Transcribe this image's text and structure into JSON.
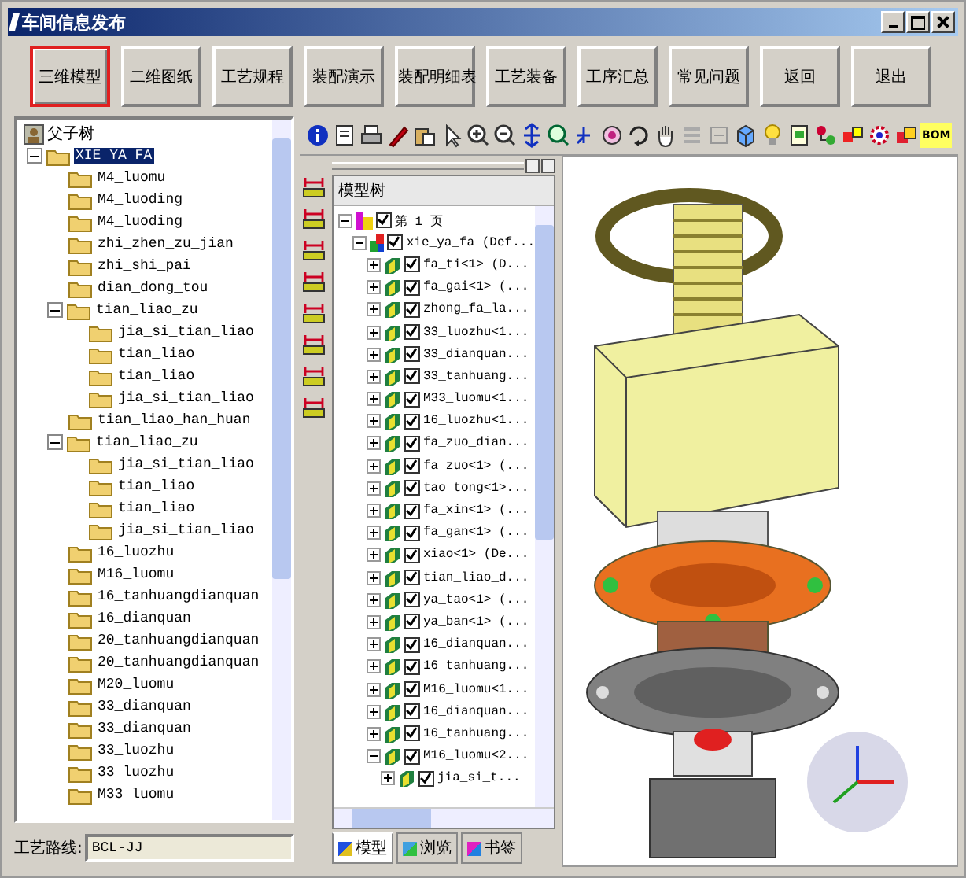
{
  "window": {
    "title": "车间信息发布"
  },
  "buttons": [
    {
      "label": "三维模型",
      "selected": true
    },
    {
      "label": "二维图纸",
      "selected": false
    },
    {
      "label": "工艺规程",
      "selected": false
    },
    {
      "label": "装配演示",
      "selected": false
    },
    {
      "label": "装配明细表",
      "selected": false
    },
    {
      "label": "工艺装备",
      "selected": false
    },
    {
      "label": "工序汇总",
      "selected": false
    },
    {
      "label": "常见问题",
      "selected": false
    },
    {
      "label": "返回",
      "selected": false
    },
    {
      "label": "退出",
      "selected": false
    }
  ],
  "parts_tree": {
    "title": "父子树",
    "items": [
      {
        "label": "XIE_YA_FA",
        "selected": true,
        "expanded": true,
        "children": [
          {
            "label": "M4_luomu",
            "selected": false
          },
          {
            "label": "M4_luoding",
            "selected": false
          },
          {
            "label": "M4_luoding",
            "selected": false
          },
          {
            "label": "zhi_zhen_zu_jian",
            "selected": false
          },
          {
            "label": "zhi_shi_pai",
            "selected": false
          },
          {
            "label": "dian_dong_tou",
            "selected": false
          },
          {
            "label": "tian_liao_zu",
            "selected": false,
            "expanded": true,
            "children": [
              {
                "label": "jia_si_tian_liao",
                "selected": false
              },
              {
                "label": "tian_liao",
                "selected": false
              },
              {
                "label": "tian_liao",
                "selected": false
              },
              {
                "label": "jia_si_tian_liao",
                "selected": false
              }
            ]
          },
          {
            "label": "tian_liao_han_huan",
            "selected": false
          },
          {
            "label": "tian_liao_zu",
            "selected": false,
            "expanded": true,
            "children": [
              {
                "label": "jia_si_tian_liao",
                "selected": false
              },
              {
                "label": "tian_liao",
                "selected": false
              },
              {
                "label": "tian_liao",
                "selected": false
              },
              {
                "label": "jia_si_tian_liao",
                "selected": false
              }
            ]
          },
          {
            "label": "16_luozhu",
            "selected": false
          },
          {
            "label": "M16_luomu",
            "selected": false
          },
          {
            "label": "16_tanhuangdianquan",
            "selected": false
          },
          {
            "label": "16_dianquan",
            "selected": false
          },
          {
            "label": "20_tanhuangdianquan",
            "selected": false
          },
          {
            "label": "20_tanhuangdianquan",
            "selected": false
          },
          {
            "label": "M20_luomu",
            "selected": false
          },
          {
            "label": "33_dianquan",
            "selected": false
          },
          {
            "label": "33_dianquan",
            "selected": false
          },
          {
            "label": "33_luozhu",
            "selected": false
          },
          {
            "label": "33_luozhu",
            "selected": false
          },
          {
            "label": "M33_luomu",
            "selected": false
          }
        ]
      }
    ]
  },
  "route": {
    "label": "工艺路线:",
    "value": "BCL-JJ"
  },
  "toolbar": {
    "bom_label": "BOM"
  },
  "model_tree": {
    "header": "模型树",
    "items": [
      {
        "kind": "page",
        "label": "第 1 页",
        "checked": true,
        "expanded": true,
        "children": [
          {
            "kind": "assembly",
            "label": "xie_ya_fa (Def...",
            "checked": true,
            "expanded": true,
            "children": [
              {
                "kind": "part",
                "label": "fa_ti<1> (D...",
                "checked": true,
                "expanded": false
              },
              {
                "kind": "part",
                "label": "fa_gai<1> (...",
                "checked": true,
                "expanded": false
              },
              {
                "kind": "part",
                "label": "zhong_fa_la...",
                "checked": true,
                "expanded": false
              },
              {
                "kind": "part",
                "label": "33_luozhu<1...",
                "checked": true,
                "expanded": false
              },
              {
                "kind": "part",
                "label": "33_dianquan...",
                "checked": true,
                "expanded": false
              },
              {
                "kind": "part",
                "label": "33_tanhuang...",
                "checked": true,
                "expanded": false
              },
              {
                "kind": "part",
                "label": "M33_luomu<1...",
                "checked": true,
                "expanded": false
              },
              {
                "kind": "part",
                "label": "16_luozhu<1...",
                "checked": true,
                "expanded": false
              },
              {
                "kind": "part",
                "label": "fa_zuo_dian...",
                "checked": true,
                "expanded": false
              },
              {
                "kind": "part",
                "label": "fa_zuo<1> (...",
                "checked": true,
                "expanded": false
              },
              {
                "kind": "part",
                "label": "tao_tong<1>...",
                "checked": true,
                "expanded": false
              },
              {
                "kind": "part",
                "label": "fa_xin<1> (...",
                "checked": true,
                "expanded": false
              },
              {
                "kind": "part",
                "label": "fa_gan<1> (...",
                "checked": true,
                "expanded": false
              },
              {
                "kind": "part",
                "label": "xiao<1> (De...",
                "checked": true,
                "expanded": false
              },
              {
                "kind": "part",
                "label": "tian_liao_d...",
                "checked": true,
                "expanded": false
              },
              {
                "kind": "part",
                "label": "ya_tao<1> (...",
                "checked": true,
                "expanded": false
              },
              {
                "kind": "part",
                "label": "ya_ban<1> (...",
                "checked": true,
                "expanded": false
              },
              {
                "kind": "part",
                "label": "16_dianquan...",
                "checked": true,
                "expanded": false
              },
              {
                "kind": "part",
                "label": "16_tanhuang...",
                "checked": true,
                "expanded": false
              },
              {
                "kind": "part",
                "label": "M16_luomu<1...",
                "checked": true,
                "expanded": false
              },
              {
                "kind": "part",
                "label": "16_dianquan...",
                "checked": true,
                "expanded": false
              },
              {
                "kind": "part",
                "label": "16_tanhuang...",
                "checked": true,
                "expanded": false
              },
              {
                "kind": "part",
                "label": "M16_luomu<2...",
                "checked": true,
                "expanded": true,
                "children": [
                  {
                    "kind": "part",
                    "label": "jia_si_t...",
                    "checked": true,
                    "expanded": false
                  }
                ]
              }
            ]
          }
        ]
      }
    ]
  },
  "tree_tabs": [
    {
      "label": "模型",
      "selected": true
    },
    {
      "label": "浏览",
      "selected": false
    },
    {
      "label": "书签",
      "selected": false
    }
  ]
}
